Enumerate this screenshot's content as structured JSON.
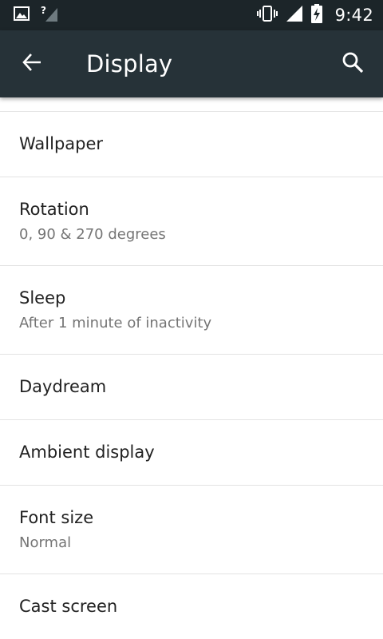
{
  "status_bar": {
    "time": "9:42",
    "icons": [
      "image-notification-icon",
      "no-sim-signal-icon",
      "vibrate-icon",
      "cell-signal-icon",
      "battery-charging-icon"
    ]
  },
  "app_bar": {
    "title": "Display",
    "back_icon": "arrow-back-icon",
    "search_icon": "search-icon"
  },
  "settings": [
    {
      "title": "Wallpaper",
      "summary": ""
    },
    {
      "title": "Rotation",
      "summary": "0, 90 & 270 degrees"
    },
    {
      "title": "Sleep",
      "summary": "After 1 minute of inactivity"
    },
    {
      "title": "Daydream",
      "summary": ""
    },
    {
      "title": "Ambient display",
      "summary": ""
    },
    {
      "title": "Font size",
      "summary": "Normal"
    },
    {
      "title": "Cast screen",
      "summary": ""
    }
  ],
  "colors": {
    "status_bar_bg": "#1c2529",
    "app_bar_bg": "#263238",
    "title_text": "#212121",
    "summary_text": "#757575",
    "divider": "#e3e3e3"
  }
}
